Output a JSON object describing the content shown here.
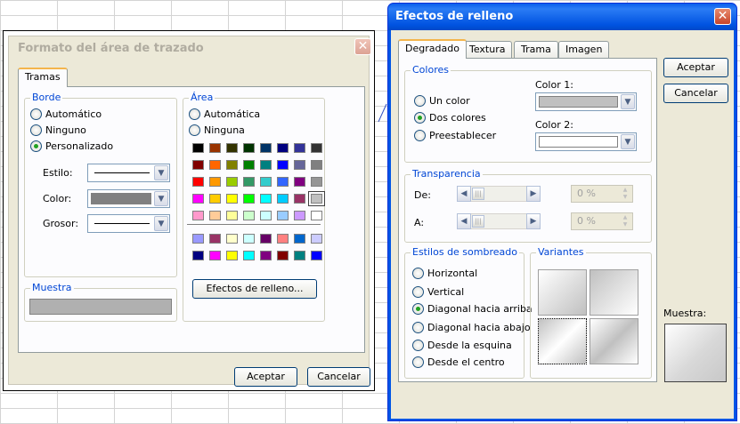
{
  "dialog1": {
    "title": "Formato del área de trazado",
    "tab": "Tramas",
    "borde": {
      "label": "Borde",
      "options": [
        "Automático",
        "Ninguno",
        "Personalizado"
      ],
      "selected": 2,
      "estilo_label": "Estilo:",
      "color_label": "Color:",
      "grosor_label": "Grosor:",
      "color_value": "#808080"
    },
    "area": {
      "label": "Área",
      "options": [
        "Automática",
        "Ninguna"
      ],
      "swatches_top": [
        [
          "#000000",
          "#993300",
          "#333300",
          "#003300",
          "#003366",
          "#000080",
          "#333399",
          "#333333"
        ],
        [
          "#800000",
          "#ff6600",
          "#808000",
          "#008000",
          "#008080",
          "#0000ff",
          "#666699",
          "#808080"
        ],
        [
          "#ff0000",
          "#ff9900",
          "#99cc00",
          "#339966",
          "#33cccc",
          "#3366ff",
          "#800080",
          "#969696"
        ],
        [
          "#ff00ff",
          "#ffcc00",
          "#ffff00",
          "#00ff00",
          "#00ffff",
          "#00ccff",
          "#993366",
          "#c0c0c0"
        ],
        [
          "#ff99cc",
          "#ffcc99",
          "#ffff99",
          "#ccffcc",
          "#ccffff",
          "#99ccff",
          "#cc99ff",
          "#ffffff"
        ]
      ],
      "swatches_bottom": [
        [
          "#9999ff",
          "#993366",
          "#ffffcc",
          "#ccffff",
          "#660066",
          "#ff8080",
          "#0066cc",
          "#ccccff"
        ],
        [
          "#000080",
          "#ff00ff",
          "#ffff00",
          "#00ffff",
          "#800080",
          "#800000",
          "#008080",
          "#0000ff"
        ]
      ],
      "effects_button": "Efectos de relleno..."
    },
    "muestra_label": "Muestra",
    "muestra_color": "#b0b0b0",
    "accept": "Aceptar",
    "cancel": "Cancelar"
  },
  "dialog2": {
    "title": "Efectos de relleno",
    "tabs": [
      "Degradado",
      "Textura",
      "Trama",
      "Imagen"
    ],
    "colores": {
      "label": "Colores",
      "options": [
        "Un color",
        "Dos colores",
        "Preestablecer"
      ],
      "selected": 1,
      "color1_label": "Color 1:",
      "color2_label": "Color 2:",
      "color1_value": "#c0c0c0",
      "color2_value": "#ffffff"
    },
    "transparencia": {
      "label": "Transparencia",
      "de_label": "De:",
      "a_label": "A:",
      "de_value": "0 %",
      "a_value": "0 %"
    },
    "sombreado": {
      "label": "Estilos de sombreado",
      "options": [
        "Horizontal",
        "Vertical",
        "Diagonal hacia arriba",
        "Diagonal hacia abajo",
        "Desde la esquina",
        "Desde el centro"
      ],
      "selected": 2
    },
    "variantes_label": "Variantes",
    "muestra_label": "Muestra:",
    "accept": "Aceptar",
    "cancel": "Cancelar"
  }
}
